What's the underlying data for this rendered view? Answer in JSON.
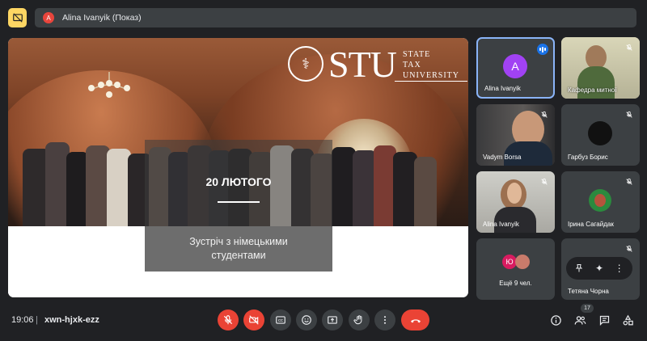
{
  "presentation_banner": {
    "avatar_letter": "A",
    "text": "Alina Ivanyik (Показ)"
  },
  "slide": {
    "logo_main": "STU",
    "logo_right": [
      "STATE",
      "TAX",
      "UNIVERSITY"
    ],
    "date": "20 ЛЮТОГО",
    "meeting_title": "Зустріч з німецькими студентами"
  },
  "participants": [
    {
      "name": "Alina Ivanyik",
      "avatar_letter": "A",
      "avatar_color": "#a142f4",
      "speaking": true
    },
    {
      "name": "Кафедра митної",
      "muted": true,
      "video": true
    },
    {
      "name": "Vadym Borsa",
      "muted": true,
      "video": true
    },
    {
      "name": "Гарбуз Борис",
      "muted": true
    },
    {
      "name": "Alina Ivanyik",
      "muted": true,
      "video": true
    },
    {
      "name": "Ірина Сагайдак",
      "muted": true
    },
    {
      "name": "Ещё 9 чел.",
      "avatar_letters": [
        "Ю"
      ]
    },
    {
      "name": "Тетяна Чорна",
      "muted": true
    }
  ],
  "bottom": {
    "time": "19:06",
    "separator": "|",
    "meeting_code": "xwn-hjxk-ezz",
    "people_count": "17"
  },
  "colors": {
    "background": "#202124",
    "tile": "#3c4043",
    "accent_yellow": "#fdd663",
    "danger_red": "#ea4335",
    "active_blue": "#8ab4f8"
  }
}
